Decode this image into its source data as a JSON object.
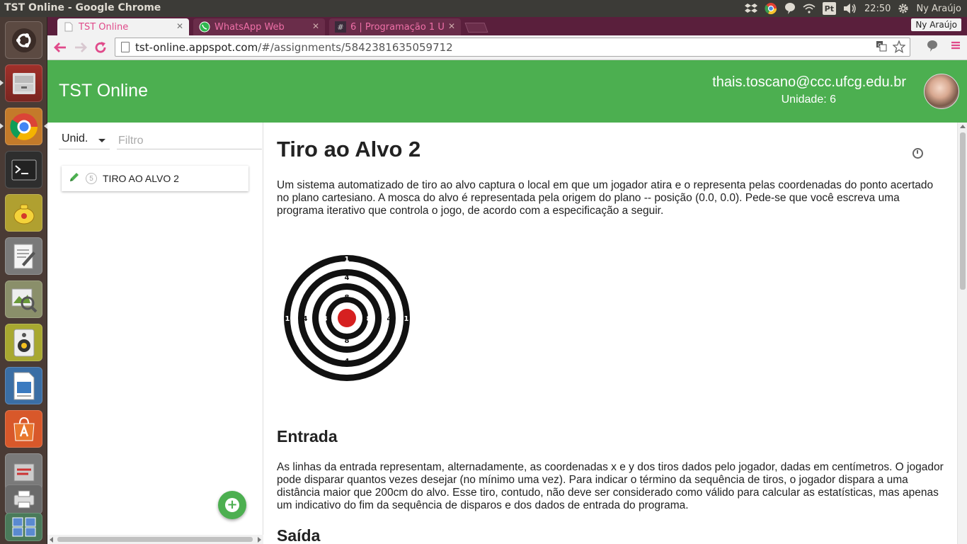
{
  "system": {
    "window_title": "TST Online - Google Chrome",
    "pt_indicator": "Pt",
    "time": "22:50",
    "user": "Ny Araújo"
  },
  "browser": {
    "tabs": [
      {
        "label": "TST Online",
        "active": true
      },
      {
        "label": "WhatsApp Web",
        "active": false
      },
      {
        "label": "6 | Programação 1 U",
        "active": false
      }
    ],
    "profile_name": "Ny Araújo",
    "url_host": "tst-online.appspot.com",
    "url_path": "/#/assignments/5842381635059712"
  },
  "app": {
    "title": "TST Online",
    "user_email": "thais.toscano@ccc.ufcg.edu.br",
    "unit_label": "Unidade: 6",
    "accent_color": "#4caf50"
  },
  "sidebar": {
    "unit_select": "Unid.",
    "filter_placeholder": "Filtro",
    "assignments": [
      {
        "number": "5",
        "title": "TIRO AO ALVO 2"
      }
    ]
  },
  "assignment": {
    "title": "Tiro ao Alvo 2",
    "intro": "Um sistema automatizado de tiro ao alvo captura o local em que um jogador atira e o representa pelas coordenadas do ponto acertado no plano cartesiano. A mosca do alvo é representada pela origem do plano -- posição (0.0, 0.0). Pede-se que você escreva uma programa iterativo que controla o jogo, de acordo com a especificação a seguir.",
    "target_labels": {
      "outer": "1",
      "middle": "4",
      "inner": "8"
    },
    "input_heading": "Entrada",
    "input_text": "As linhas da entrada representam, alternadamente, as coordenadas x e y dos tiros dados pelo jogador, dadas em centímetros. O jogador pode disparar quantos vezes desejar (no mínimo uma vez). Para indicar o término da sequência de tiros, o jogador dispara a uma distância maior que 200cm do alvo. Esse tiro, contudo, não deve ser considerado como válido para calcular as estatísticas, mas apenas um indicativo do fim da sequência de disparos e dos dados de entrada do programa.",
    "output_heading": "Saída"
  }
}
